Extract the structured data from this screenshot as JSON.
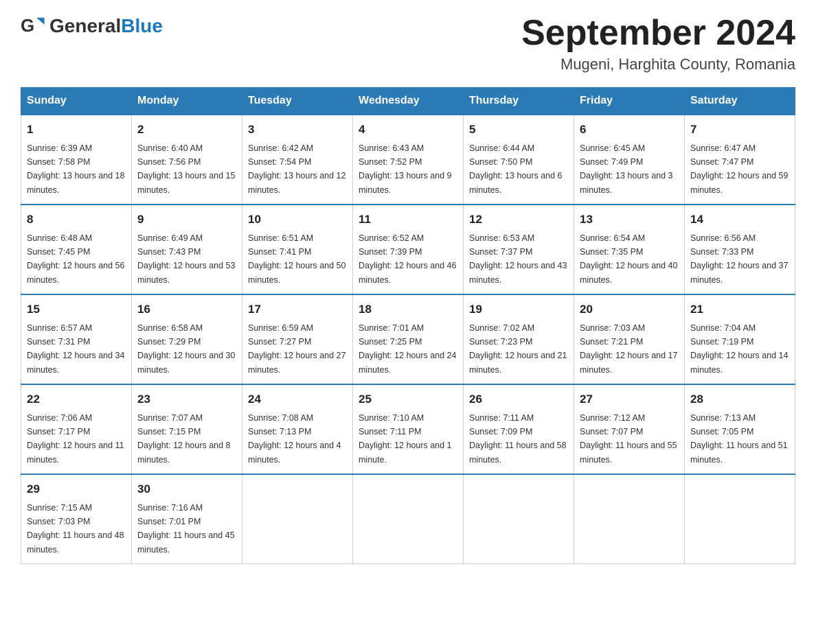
{
  "header": {
    "logo_general": "General",
    "logo_blue": "Blue",
    "month_title": "September 2024",
    "location": "Mugeni, Harghita County, Romania"
  },
  "days_of_week": [
    "Sunday",
    "Monday",
    "Tuesday",
    "Wednesday",
    "Thursday",
    "Friday",
    "Saturday"
  ],
  "weeks": [
    [
      {
        "day": "1",
        "sunrise": "6:39 AM",
        "sunset": "7:58 PM",
        "daylight": "13 hours and 18 minutes."
      },
      {
        "day": "2",
        "sunrise": "6:40 AM",
        "sunset": "7:56 PM",
        "daylight": "13 hours and 15 minutes."
      },
      {
        "day": "3",
        "sunrise": "6:42 AM",
        "sunset": "7:54 PM",
        "daylight": "13 hours and 12 minutes."
      },
      {
        "day": "4",
        "sunrise": "6:43 AM",
        "sunset": "7:52 PM",
        "daylight": "13 hours and 9 minutes."
      },
      {
        "day": "5",
        "sunrise": "6:44 AM",
        "sunset": "7:50 PM",
        "daylight": "13 hours and 6 minutes."
      },
      {
        "day": "6",
        "sunrise": "6:45 AM",
        "sunset": "7:49 PM",
        "daylight": "13 hours and 3 minutes."
      },
      {
        "day": "7",
        "sunrise": "6:47 AM",
        "sunset": "7:47 PM",
        "daylight": "12 hours and 59 minutes."
      }
    ],
    [
      {
        "day": "8",
        "sunrise": "6:48 AM",
        "sunset": "7:45 PM",
        "daylight": "12 hours and 56 minutes."
      },
      {
        "day": "9",
        "sunrise": "6:49 AM",
        "sunset": "7:43 PM",
        "daylight": "12 hours and 53 minutes."
      },
      {
        "day": "10",
        "sunrise": "6:51 AM",
        "sunset": "7:41 PM",
        "daylight": "12 hours and 50 minutes."
      },
      {
        "day": "11",
        "sunrise": "6:52 AM",
        "sunset": "7:39 PM",
        "daylight": "12 hours and 46 minutes."
      },
      {
        "day": "12",
        "sunrise": "6:53 AM",
        "sunset": "7:37 PM",
        "daylight": "12 hours and 43 minutes."
      },
      {
        "day": "13",
        "sunrise": "6:54 AM",
        "sunset": "7:35 PM",
        "daylight": "12 hours and 40 minutes."
      },
      {
        "day": "14",
        "sunrise": "6:56 AM",
        "sunset": "7:33 PM",
        "daylight": "12 hours and 37 minutes."
      }
    ],
    [
      {
        "day": "15",
        "sunrise": "6:57 AM",
        "sunset": "7:31 PM",
        "daylight": "12 hours and 34 minutes."
      },
      {
        "day": "16",
        "sunrise": "6:58 AM",
        "sunset": "7:29 PM",
        "daylight": "12 hours and 30 minutes."
      },
      {
        "day": "17",
        "sunrise": "6:59 AM",
        "sunset": "7:27 PM",
        "daylight": "12 hours and 27 minutes."
      },
      {
        "day": "18",
        "sunrise": "7:01 AM",
        "sunset": "7:25 PM",
        "daylight": "12 hours and 24 minutes."
      },
      {
        "day": "19",
        "sunrise": "7:02 AM",
        "sunset": "7:23 PM",
        "daylight": "12 hours and 21 minutes."
      },
      {
        "day": "20",
        "sunrise": "7:03 AM",
        "sunset": "7:21 PM",
        "daylight": "12 hours and 17 minutes."
      },
      {
        "day": "21",
        "sunrise": "7:04 AM",
        "sunset": "7:19 PM",
        "daylight": "12 hours and 14 minutes."
      }
    ],
    [
      {
        "day": "22",
        "sunrise": "7:06 AM",
        "sunset": "7:17 PM",
        "daylight": "12 hours and 11 minutes."
      },
      {
        "day": "23",
        "sunrise": "7:07 AM",
        "sunset": "7:15 PM",
        "daylight": "12 hours and 8 minutes."
      },
      {
        "day": "24",
        "sunrise": "7:08 AM",
        "sunset": "7:13 PM",
        "daylight": "12 hours and 4 minutes."
      },
      {
        "day": "25",
        "sunrise": "7:10 AM",
        "sunset": "7:11 PM",
        "daylight": "12 hours and 1 minute."
      },
      {
        "day": "26",
        "sunrise": "7:11 AM",
        "sunset": "7:09 PM",
        "daylight": "11 hours and 58 minutes."
      },
      {
        "day": "27",
        "sunrise": "7:12 AM",
        "sunset": "7:07 PM",
        "daylight": "11 hours and 55 minutes."
      },
      {
        "day": "28",
        "sunrise": "7:13 AM",
        "sunset": "7:05 PM",
        "daylight": "11 hours and 51 minutes."
      }
    ],
    [
      {
        "day": "29",
        "sunrise": "7:15 AM",
        "sunset": "7:03 PM",
        "daylight": "11 hours and 48 minutes."
      },
      {
        "day": "30",
        "sunrise": "7:16 AM",
        "sunset": "7:01 PM",
        "daylight": "11 hours and 45 minutes."
      },
      null,
      null,
      null,
      null,
      null
    ]
  ]
}
